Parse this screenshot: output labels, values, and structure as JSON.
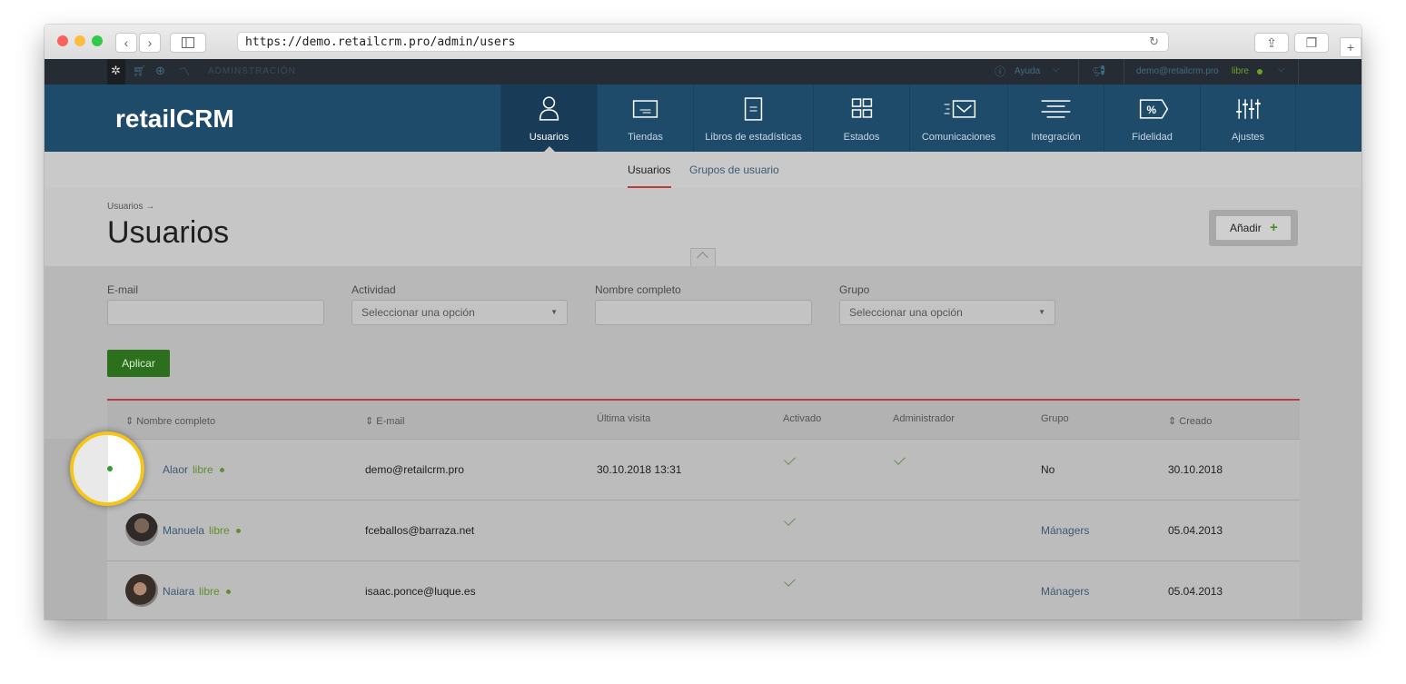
{
  "browser": {
    "url": "https://demo.retailcrm.pro/admin/users",
    "back_icon": "chevron-left-icon",
    "forward_icon": "chevron-right-icon"
  },
  "adminbar": {
    "section_label": "ADMINSTRACIÓN",
    "help_label": "Ayuda",
    "user_email": "demo@retailcrm.pro",
    "user_status": "libre"
  },
  "header": {
    "logo": "retailCRM",
    "nav": [
      {
        "label": "Usuarios",
        "icon": "user-icon"
      },
      {
        "label": "Tiendas",
        "icon": "store-icon"
      },
      {
        "label": "Libros de estadísticas",
        "icon": "book-icon"
      },
      {
        "label": "Estados",
        "icon": "grid-icon"
      },
      {
        "label": "Comunicaciones",
        "icon": "mail-icon"
      },
      {
        "label": "Integración",
        "icon": "integration-icon"
      },
      {
        "label": "Fidelidad",
        "icon": "percent-icon"
      },
      {
        "label": "Ajustes",
        "icon": "sliders-icon"
      }
    ]
  },
  "subnav": {
    "tab_users": "Usuarios",
    "tab_groups": "Grupos de usuario"
  },
  "page": {
    "breadcrumb": "Usuarios →",
    "title": "Usuarios",
    "add_button": "Añadir",
    "add_icon": "+"
  },
  "filters": {
    "email_label": "E-mail",
    "activity_label": "Actividad",
    "activity_placeholder": "Seleccionar una opción",
    "fullname_label": "Nombre completo",
    "group_label": "Grupo",
    "group_placeholder": "Seleccionar una opción",
    "apply_label": "Aplicar"
  },
  "table": {
    "columns": [
      "Nombre completo",
      "E-mail",
      "Última visita",
      "Activado",
      "Administrador",
      "Grupo",
      "Creado"
    ],
    "rows": [
      {
        "name": "Alaor",
        "status": "libre",
        "email": "demo@retailcrm.pro",
        "last_visit": "30.10.2018 13:31",
        "activated": true,
        "admin": true,
        "group": "No",
        "created": "30.10.2018"
      },
      {
        "name": "Manuela",
        "status": "libre",
        "email": "fceballos@barraza.net",
        "last_visit": "",
        "activated": true,
        "admin": false,
        "group": "Mánagers",
        "created": "05.04.2013"
      },
      {
        "name": "Naiara",
        "status": "libre",
        "email": "isaac.ponce@luque.es",
        "last_visit": "",
        "activated": true,
        "admin": false,
        "group": "Mánagers",
        "created": "05.04.2013"
      }
    ]
  }
}
